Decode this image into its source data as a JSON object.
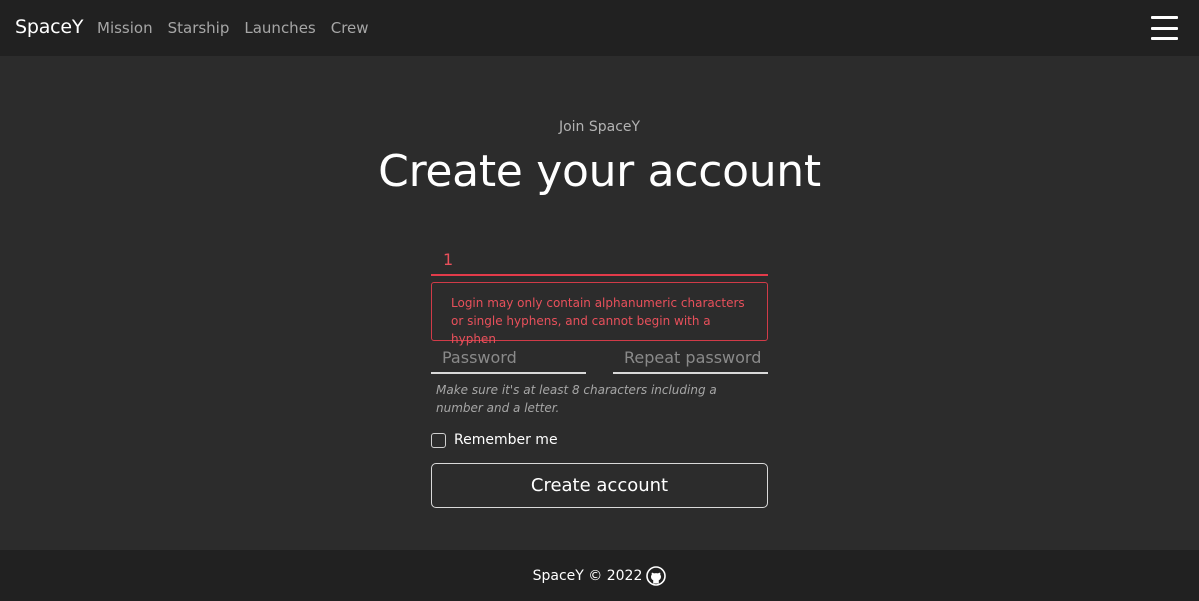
{
  "navbar": {
    "brand": "SpaceY",
    "links": [
      "Mission",
      "Starship",
      "Launches",
      "Crew"
    ],
    "menu_icon": "hamburger-menu-icon"
  },
  "header": {
    "subtitle": "Join SpaceY",
    "title": "Create your account"
  },
  "form": {
    "login_value": "1",
    "login_error": "Login may only contain alphanumeric characters or single hyphens, and cannot begin with a hyphen",
    "password_placeholder": "Password",
    "repeat_password_placeholder": "Repeat password",
    "password_hint": "Make sure it's at least 8 characters including a number and a letter.",
    "remember_label": "Remember me",
    "remember_checked": false,
    "submit_label": "Create account"
  },
  "footer": {
    "text": "SpaceY © 2022",
    "icon": "github-icon"
  },
  "colors": {
    "background": "#2c2c2c",
    "navbar": "#212121",
    "error": "#e8505b"
  }
}
